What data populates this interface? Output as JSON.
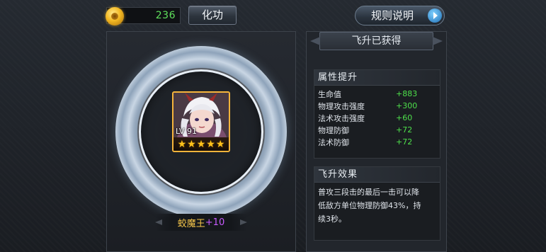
{
  "top_bar": {
    "currency_value": "236",
    "huagong_label": "化功",
    "rules_label": "规则说明"
  },
  "hero": {
    "level_text": "LV 91",
    "stars": 5,
    "name": "蛟魔王",
    "plus": "+10"
  },
  "ascend": {
    "banner": "飞升已获得",
    "attr_title": "属性提升",
    "attributes": [
      {
        "name": "生命值",
        "value": "+883"
      },
      {
        "name": "物理攻击强度",
        "value": "+300"
      },
      {
        "name": "法术攻击强度",
        "value": "+60"
      },
      {
        "name": "物理防御",
        "value": "+72"
      },
      {
        "name": "法术防御",
        "value": "+72"
      }
    ],
    "effect_title": "飞升效果",
    "effect_lines": [
      "普攻三段击的最后一击可以降",
      "低敌方单位物理防御43%，持",
      "续3秒。"
    ]
  },
  "colors": {
    "currency_green": "#5fe05c",
    "attr_value_green": "#4ee04b",
    "hero_name_gold": "#f4c54a",
    "plus_purple": "#c75bff",
    "frame_orange": "#f6b43b"
  },
  "icons": {
    "currency": "gold-coin-icon",
    "rules_arrow": "play-arrow-icon",
    "star": "star-icon"
  }
}
